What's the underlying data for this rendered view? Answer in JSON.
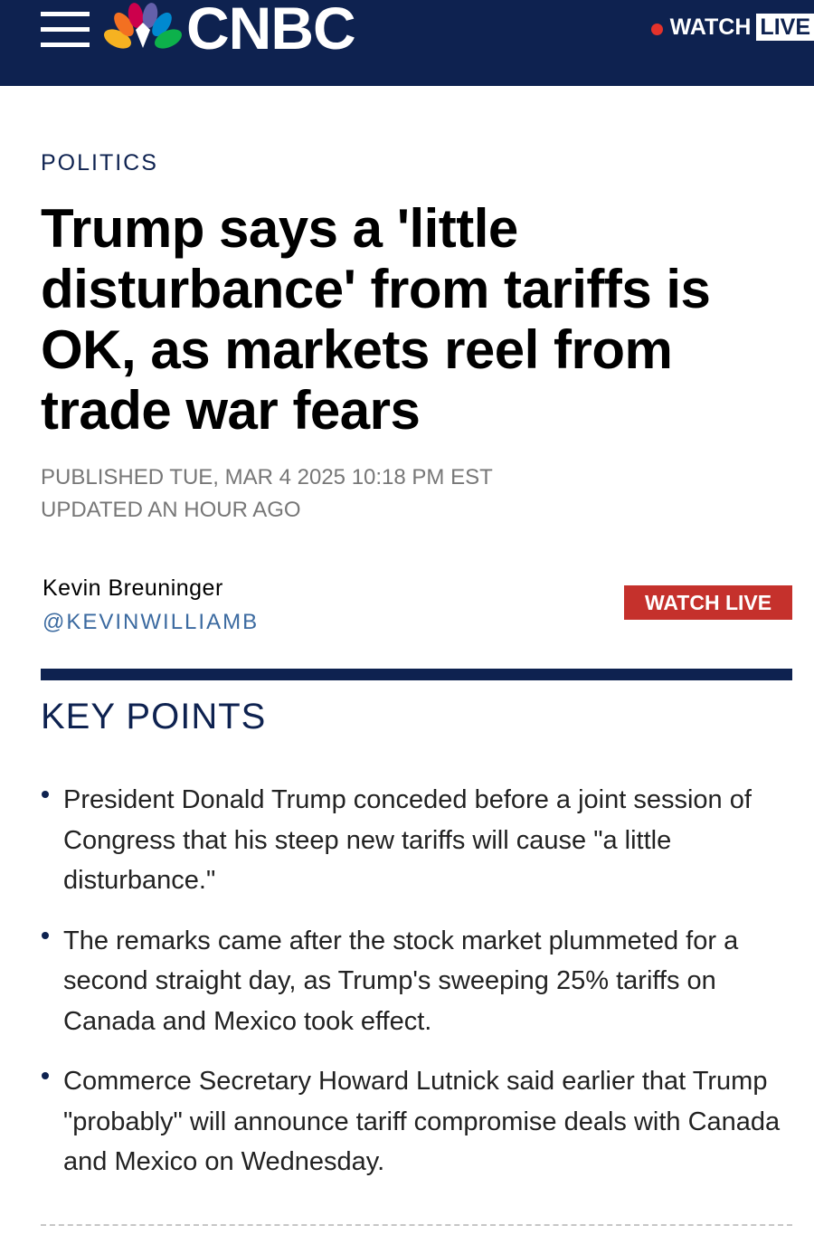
{
  "header": {
    "brand": "CNBC",
    "watch_label": "WATCH",
    "live_label": "LIVE",
    "live_dot_color": "#e4322b",
    "background_color": "#0e2250",
    "menu_icon": "hamburger-menu-icon",
    "logo_icon": "peacock-logo-icon"
  },
  "article": {
    "category": "POLITICS",
    "headline": "Trump says a 'little disturbance' from tariffs is OK, as markets reel from trade war fears",
    "published": "PUBLISHED TUE, MAR 4 2025 10:18 PM EST",
    "updated": "UPDATED AN HOUR AGO",
    "author": {
      "name": "Kevin Breuninger",
      "handle": "@KEVINWILLIAMB"
    },
    "watch_live_button": "WATCH LIVE",
    "watch_live_color": "#c5312c"
  },
  "key_points": {
    "title": "KEY POINTS",
    "items": [
      "President Donald Trump conceded before a joint session of Congress that his steep new tariffs will cause \"a little disturbance.\"",
      "The remarks came after the stock market plummeted for a second straight day, as Trump's sweeping 25% tariffs on Canada and Mexico took effect.",
      "Commerce Secretary Howard Lutnick said earlier that Trump \"probably\" will announce tariff compromise deals with Canada and Mexico on Wednesday."
    ]
  }
}
